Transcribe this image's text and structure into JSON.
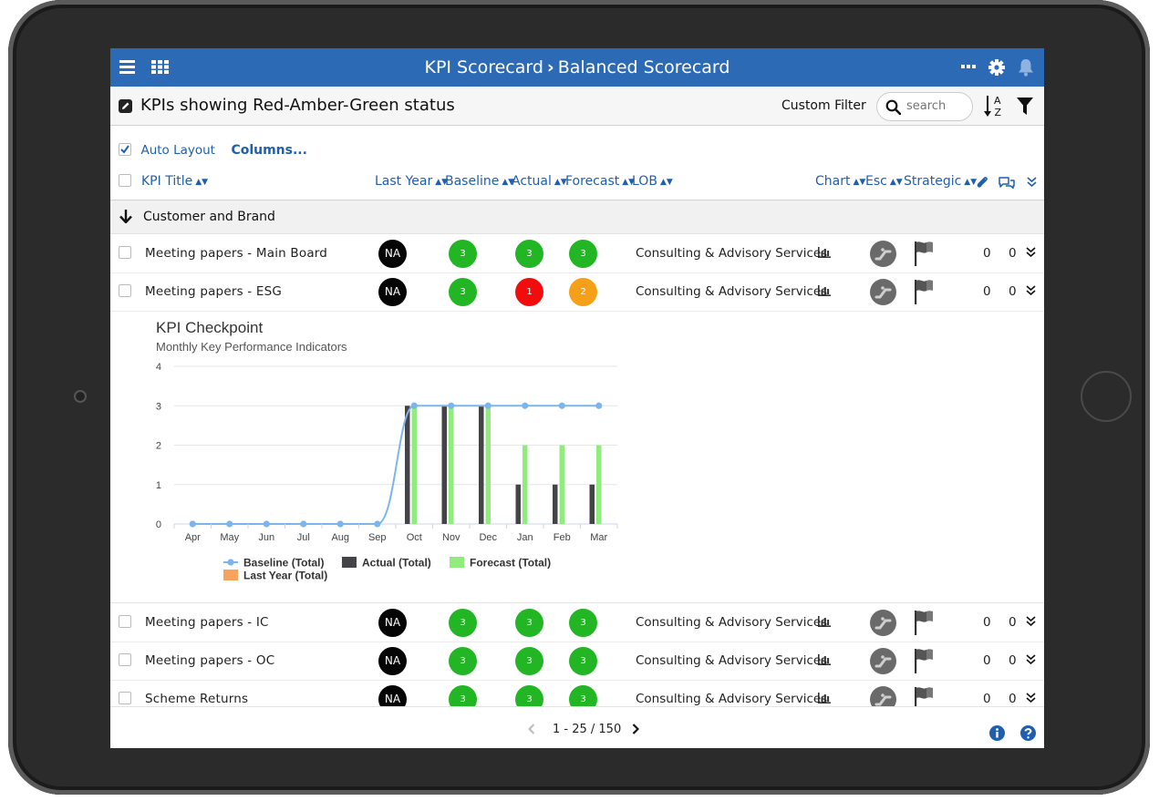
{
  "app": {
    "breadcrumb_root": "KPI Scorecard",
    "breadcrumb_separator": "›",
    "breadcrumb_current": "Balanced Scorecard"
  },
  "header": {
    "page_title": "KPIs showing Red-Amber-Green status",
    "custom_filter_label": "Custom Filter",
    "search_placeholder": "search"
  },
  "toolbar": {
    "auto_layout_label": "Auto Layout",
    "auto_layout_checked": true,
    "columns_label": "Columns..."
  },
  "columns": {
    "kpi_title": "KPI Title",
    "last_year": "Last Year",
    "baseline": "Baseline",
    "actual": "Actual",
    "forecast": "Forecast",
    "lob": "LOB",
    "chart": "Chart",
    "esc": "Esc",
    "strategic": "Strategic"
  },
  "group": {
    "label": "Customer and Brand"
  },
  "rows": [
    {
      "title": "Meeting papers - Main Board",
      "last_year": "NA",
      "baseline": "3",
      "actual": "3",
      "forecast": "3",
      "lob": "Consulting & Advisory Services",
      "attachments": "0",
      "comments": "0"
    },
    {
      "title": "Meeting papers - ESG",
      "last_year": "NA",
      "baseline": "3",
      "actual": "1",
      "forecast": "2",
      "lob": "Consulting & Advisory Services",
      "attachments": "0",
      "comments": "0"
    },
    {
      "title": "Meeting papers - IC",
      "last_year": "NA",
      "baseline": "3",
      "actual": "3",
      "forecast": "3",
      "lob": "Consulting & Advisory Services",
      "attachments": "0",
      "comments": "0"
    },
    {
      "title": "Meeting papers - OC",
      "last_year": "NA",
      "baseline": "3",
      "actual": "3",
      "forecast": "3",
      "lob": "Consulting & Advisory Services",
      "attachments": "0",
      "comments": "0"
    },
    {
      "title": "Scheme Returns",
      "last_year": "NA",
      "baseline": "3",
      "actual": "3",
      "forecast": "3",
      "lob": "Consulting & Advisory Services",
      "attachments": "0",
      "comments": "0"
    }
  ],
  "status_colors": {
    "na": "#050505",
    "green": "#22b524",
    "red": "#f20d0d",
    "amber": "#f5a018"
  },
  "chart_data": {
    "type": "bar",
    "title": "KPI Checkpoint",
    "subtitle": "Monthly Key Performance Indicators",
    "categories": [
      "Apr",
      "May",
      "Jun",
      "Jul",
      "Aug",
      "Sep",
      "Oct",
      "Nov",
      "Dec",
      "Jan",
      "Feb",
      "Mar"
    ],
    "ylim": [
      0,
      4
    ],
    "yticks": [
      0,
      1,
      2,
      3,
      4
    ],
    "grid": true,
    "legend_position": "bottom",
    "series": [
      {
        "name": "Baseline (Total)",
        "type": "line",
        "color": "#7cb5ec",
        "values": [
          0,
          0,
          0,
          0,
          0,
          0,
          3,
          3,
          3,
          3,
          3,
          3
        ]
      },
      {
        "name": "Actual (Total)",
        "type": "bar",
        "color": "#434348",
        "values": [
          null,
          null,
          null,
          null,
          null,
          null,
          3,
          3,
          3,
          1,
          1,
          1
        ]
      },
      {
        "name": "Forecast (Total)",
        "type": "bar",
        "color": "#90ed7d",
        "values": [
          null,
          null,
          null,
          null,
          null,
          null,
          3,
          3,
          3,
          2,
          2,
          2
        ]
      },
      {
        "name": "Last Year (Total)",
        "type": "bar",
        "color": "#f7a35c",
        "values": [
          null,
          null,
          null,
          null,
          null,
          null,
          null,
          null,
          null,
          null,
          null,
          null
        ]
      }
    ]
  },
  "pagination": {
    "label": "1 - 25 / 150"
  }
}
